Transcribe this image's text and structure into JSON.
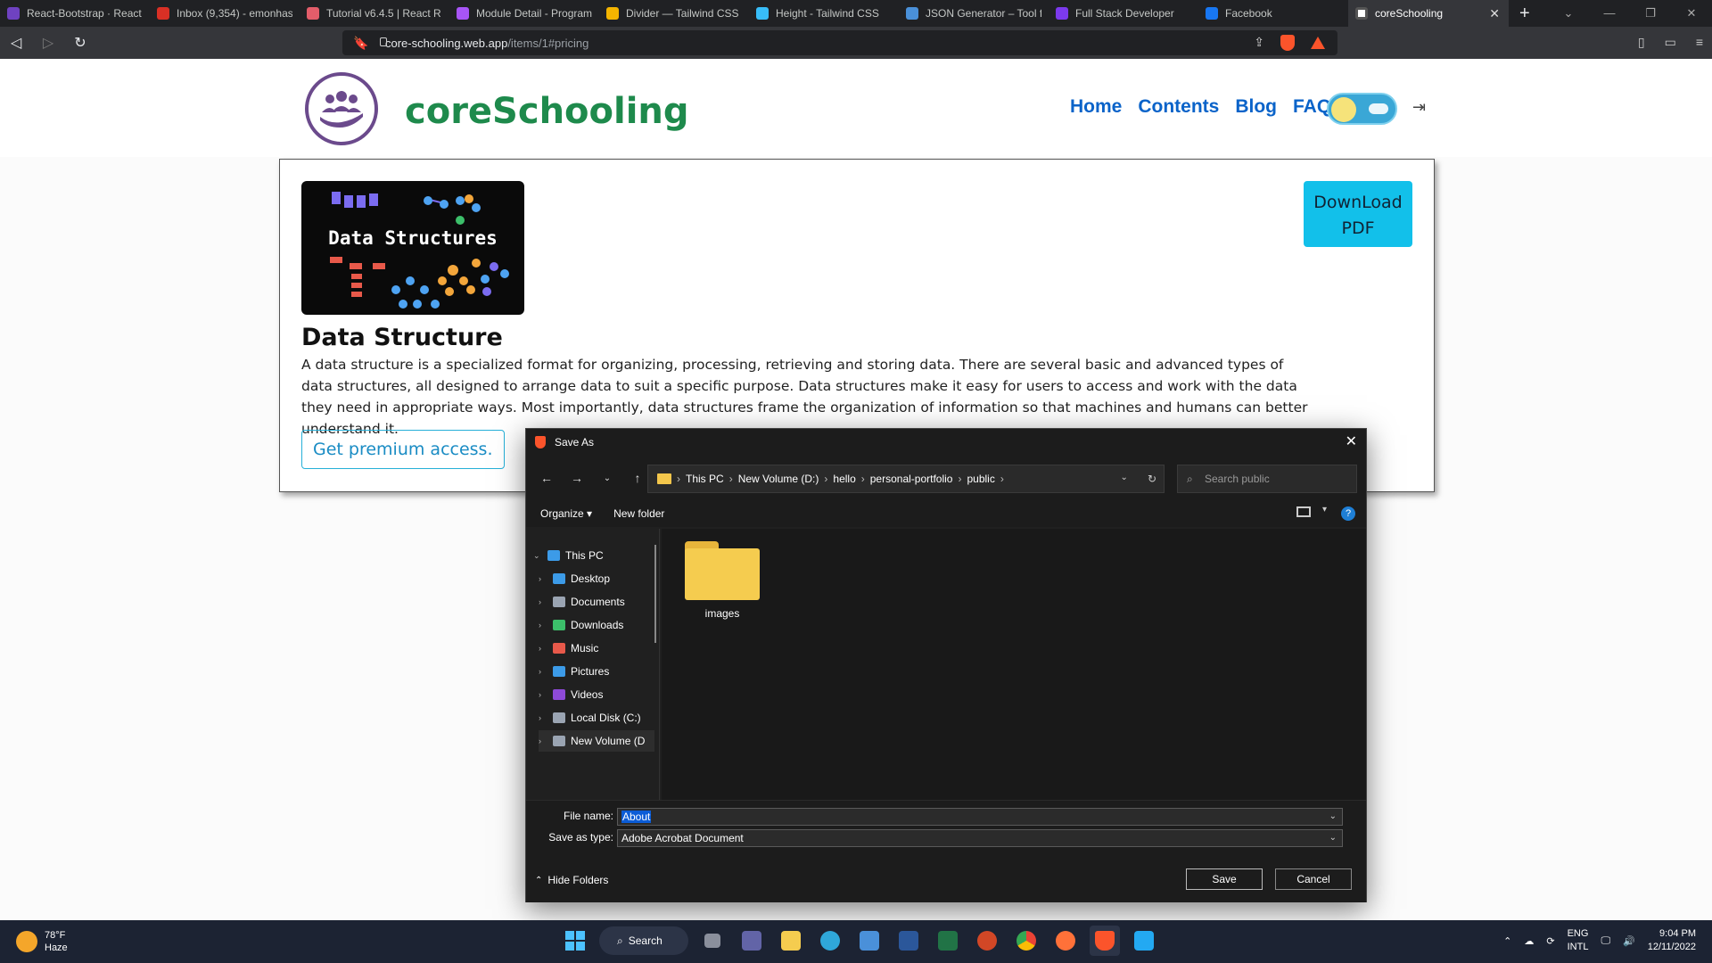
{
  "browser": {
    "tabs": [
      {
        "label": "React-Bootstrap · React",
        "color": "#6f42c1"
      },
      {
        "label": "Inbox (9,354) - emonhas",
        "color": "#d93025"
      },
      {
        "label": "Tutorial v6.4.5 | React R",
        "color": "#e35d6a"
      },
      {
        "label": "Module Detail - Program",
        "color": "#a855f7"
      },
      {
        "label": "Divider — Tailwind CSS",
        "color": "#f4b400"
      },
      {
        "label": "Height - Tailwind CSS",
        "color": "#38bdf8"
      },
      {
        "label": "JSON Generator – Tool f",
        "color": "#4a90d9"
      },
      {
        "label": "Full Stack Developer",
        "color": "#7c3aed"
      },
      {
        "label": "Facebook",
        "color": "#1877f2"
      }
    ],
    "active_tab": {
      "label": "coreSchooling",
      "color": "#ffffff"
    },
    "url_host": "core-schooling.web.app",
    "url_path": "/items/1#pricing"
  },
  "site": {
    "title": "coreSchooling",
    "nav": [
      "Home",
      "Contents",
      "Blog",
      "FAQ"
    ],
    "colors": {
      "title": "#1e8a4c",
      "nav": "#0a63c9",
      "logo": "#6b4a8c"
    }
  },
  "card": {
    "thumb_title": "Data Structures",
    "title": "Data Structure",
    "description": "A data structure is a specialized format for organizing, processing, retrieving and storing data. There are several basic and advanced types of data structures, all designed to arrange data to suit a specific purpose. Data structures make it easy for users to access and work with the data they need in appropriate ways. Most importantly, data structures frame the organization of information so that machines and humans can better understand it.",
    "premium_label": "Get premium access.",
    "download_label": "DownLoad PDF"
  },
  "dialog": {
    "title": "Save As",
    "path": [
      "This PC",
      "New Volume (D:)",
      "hello",
      "personal-portfolio",
      "public"
    ],
    "search_placeholder": "Search public",
    "organize": "Organize",
    "new_folder": "New folder",
    "tree": [
      {
        "label": "This PC",
        "icon": "pc-icon",
        "color": "#3c9be8"
      },
      {
        "label": "Desktop",
        "icon": "desktop-icon",
        "color": "#3c9be8"
      },
      {
        "label": "Documents",
        "icon": "documents-icon",
        "color": "#9aa4b2"
      },
      {
        "label": "Downloads",
        "icon": "downloads-icon",
        "color": "#3cbf6a"
      },
      {
        "label": "Music",
        "icon": "music-icon",
        "color": "#e8594a"
      },
      {
        "label": "Pictures",
        "icon": "pictures-icon",
        "color": "#3c9be8"
      },
      {
        "label": "Videos",
        "icon": "videos-icon",
        "color": "#8e4ad8"
      },
      {
        "label": "Local Disk (C:)",
        "icon": "disk-icon",
        "color": "#9aa4b2"
      },
      {
        "label": "New Volume (D",
        "icon": "disk-icon",
        "color": "#9aa4b2"
      }
    ],
    "folder_name": "images",
    "file_name_label": "File name:",
    "file_name": "About",
    "save_type_label": "Save as type:",
    "save_type": "Adobe Acrobat Document",
    "hide_folders": "Hide Folders",
    "save": "Save",
    "cancel": "Cancel"
  },
  "taskbar": {
    "temp": "78°F",
    "weather": "Haze",
    "search": "Search",
    "lang1": "ENG",
    "lang2": "INTL",
    "time": "9:04 PM",
    "date": "12/11/2022"
  }
}
